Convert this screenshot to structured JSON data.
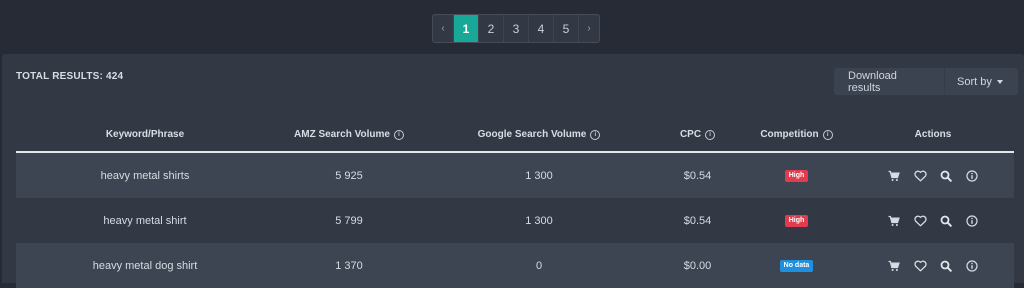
{
  "pagination": {
    "prev": "‹",
    "next": "›",
    "pages": [
      "1",
      "2",
      "3",
      "4",
      "5"
    ],
    "active": "1"
  },
  "summary": {
    "total_label": "TOTAL RESULTS: 424"
  },
  "toolbar": {
    "download_label": "Download results",
    "sort_label": "Sort by"
  },
  "table": {
    "columns": {
      "keyword": "Keyword/Phrase",
      "amz": "AMZ Search Volume",
      "google": "Google Search Volume",
      "cpc": "CPC",
      "competition": "Competition",
      "actions": "Actions"
    },
    "rows": [
      {
        "keyword": "heavy metal shirts",
        "amz": "5 925",
        "google": "1 300",
        "cpc": "$0.54",
        "competition": "High"
      },
      {
        "keyword": "heavy metal shirt",
        "amz": "5 799",
        "google": "1 300",
        "cpc": "$0.54",
        "competition": "High"
      },
      {
        "keyword": "heavy metal dog shirt",
        "amz": "1 370",
        "google": "0",
        "cpc": "$0.00",
        "competition": "No data"
      }
    ]
  },
  "icons": {
    "cart": "cart-icon",
    "favorite": "heart-icon",
    "search": "search-icon",
    "info": "info-icon"
  },
  "colors": {
    "accent": "#17a897",
    "high": "#e03b4f",
    "no_data": "#1f8fde"
  }
}
